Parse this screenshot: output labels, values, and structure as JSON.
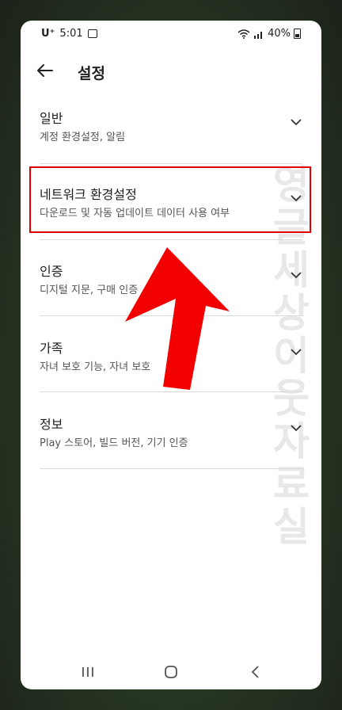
{
  "status": {
    "carrier": "U⁺",
    "time": "5:01",
    "battery": "40%"
  },
  "appbar": {
    "title": "설정"
  },
  "items": [
    {
      "title": "일반",
      "subtitle": "계정 환경설정, 알림"
    },
    {
      "title": "네트워크 환경설정",
      "subtitle": "다운로드 및 자동 업데이트 데이터 사용 여부"
    },
    {
      "title": "인증",
      "subtitle": "디지털 지문, 구매 인증"
    },
    {
      "title": "가족",
      "subtitle": "자녀 보호 기능, 자녀 보호"
    },
    {
      "title": "정보",
      "subtitle": "Play 스토어, 빌드 버전, 기기 인증"
    }
  ],
  "watermark": "영글세상이웃자료실",
  "colors": {
    "highlight": "#e00000",
    "arrow": "#f20000"
  }
}
